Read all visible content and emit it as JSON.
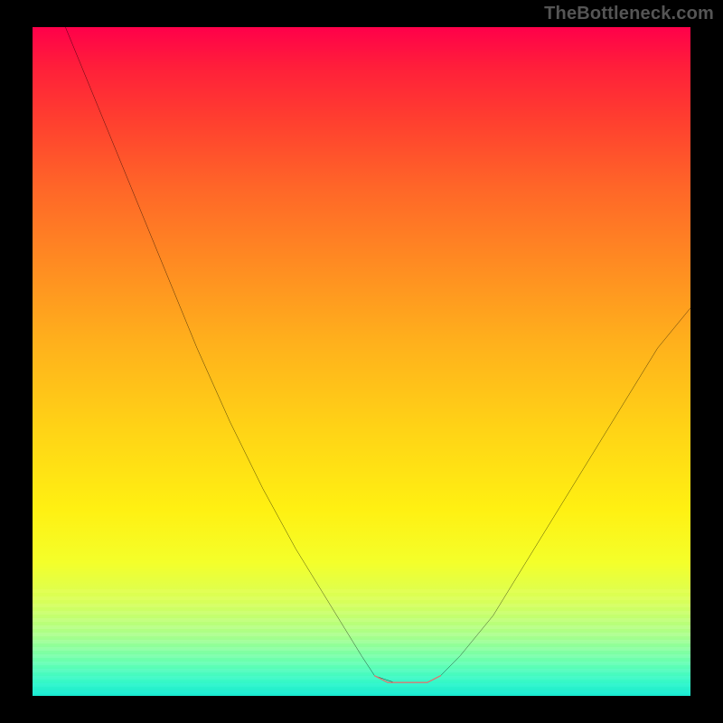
{
  "watermark": "TheBottleneck.com",
  "chart_data": {
    "type": "line",
    "title": "",
    "xlabel": "",
    "ylabel": "",
    "xlim": [
      0,
      100
    ],
    "ylim": [
      0,
      100
    ],
    "curve_main": {
      "description": "Black V-shaped bottleneck curve; high at left, drops steeply to near 0 around x≈52-62, rises again toward the right",
      "x": [
        5,
        10,
        15,
        20,
        25,
        30,
        35,
        40,
        45,
        50,
        52,
        55,
        58,
        60,
        62,
        65,
        70,
        75,
        80,
        85,
        90,
        95,
        100
      ],
      "y": [
        100,
        88,
        76,
        64,
        52,
        41,
        31,
        22,
        14,
        6,
        3,
        2,
        2,
        2,
        3,
        6,
        12,
        20,
        28,
        36,
        44,
        52,
        58
      ]
    },
    "highlight_band": {
      "description": "Short salmon/red flat segment along the trough indicating good-match zone",
      "x": [
        52,
        54,
        56,
        58,
        60,
        62
      ],
      "y": [
        3,
        2,
        2,
        2,
        2,
        3
      ],
      "color": "#d87a74"
    },
    "gradient": {
      "orientation": "vertical",
      "stops": [
        {
          "pos": 0.0,
          "color": "#ff004a"
        },
        {
          "pos": 0.24,
          "color": "#ff6628"
        },
        {
          "pos": 0.47,
          "color": "#ffb01c"
        },
        {
          "pos": 0.72,
          "color": "#fff012"
        },
        {
          "pos": 0.91,
          "color": "#a8ff8a"
        },
        {
          "pos": 1.0,
          "color": "#18e8d0"
        }
      ]
    }
  }
}
